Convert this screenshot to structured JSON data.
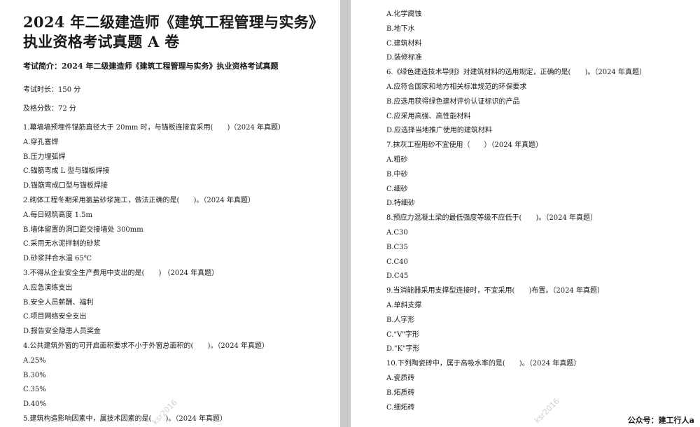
{
  "left_page": {
    "title_line1": "2024 年二级建造师《建筑工程管理与实务》",
    "title_line2": "执业资格考试真题 A 卷",
    "intro": "考试简介：2024 年二级建造师《建筑工程管理与实务》执业资格考试真题",
    "duration": "考试时长：150 分",
    "pass_score": "及格分数：72 分",
    "lines": [
      "1.幕墙墙预埋件锚筋直径大于 20mm 时，与锚板连接宜采用(　　)（2024 年真题）",
      "A.穿孔塞焊",
      "B.压力埋弧焊",
      "C.锚筋弯成 L 型与锚板焊接",
      "D.锚筋弯成口型与锚板焊接",
      "2.砌体工程冬期采用氯盐砂浆施工，做法正确的是(　　)。（2024 年真题）",
      "A.每日砌筑高度 1.5m",
      "B.墙体留置的洞口距交接墙处 300mm",
      "C.采用无水泥拌制的砂浆",
      "D.砂浆拌合水温 65℃",
      "3.不得从企业安全生产费用中支出的是(　　) （2024 年真题）",
      "A.应急演练支出",
      "B.安全人员薪酬、福利",
      "C.项目网络安全支出",
      "D.报告安全隐患人员奖金",
      "4.公共建筑外窗的可开启面积要求不小于外窗总面积的(　　)。（2024 年真题）",
      "A.25%",
      "B.30%",
      "C.35%",
      "D.40%",
      "5.建筑构造影响因素中，属技术因素的是(　　)。（2024 年真题）"
    ]
  },
  "right_page": {
    "lines": [
      "A.化学腐蚀",
      "B.地下水",
      "C.建筑材料",
      "D.装修标准",
      "6.《绿色建造技术导则》对建筑材料的选用规定，正确的是(　　)。（2024 年真题）",
      "A.应符合国家和地方相关标准规范的环保要求",
      "B.应选用获得绿色建材评价认证标识的产品",
      "C.应采用高强、高性能材料",
      "D.应选择当地推广使用的建筑材料",
      "7.抹灰工程用砂不宜使用（　　）（2024 年真题）",
      "A.粗砂",
      "B.中砂",
      "C.细砂",
      "D.特细砂",
      "8.预应力混凝土梁的最低强度等级不应低于(　　)。（2024 年真题）",
      "A.C30",
      "B.C35",
      "C.C40",
      "D.C45",
      "9.当消能器采用支撑型连接时，不宜采用(　　)布置。（2024 年真题）",
      "A.单斜支撑",
      "B.人字形",
      "C.\"V\"字形",
      "D.\"K\"字形",
      "10.下列陶瓷砖中，属于高吸水率的是(　　)。（2024 年真题）",
      "A.瓷质砖",
      "B.炻质砖",
      "C.细炻砖"
    ]
  },
  "watermark_text": "ksr2016",
  "footer_note": "公众号：建工行人a",
  "colors": {
    "page_bg": "#ffffff",
    "gap_bg": "#c9c9c9",
    "text": "#1a1a1a"
  }
}
